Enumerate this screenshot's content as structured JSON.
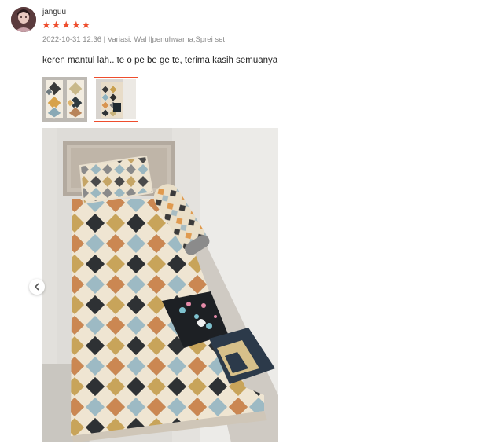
{
  "review": {
    "username": "janguu",
    "rating": 5,
    "meta": "2022-10-31 12:36 | Variasi: Wal l|penuhwarna,Sprei set",
    "comment": "keren mantul lah.. te o pe be ge te, terima kasih semuanya"
  },
  "icons": {
    "star": "star-icon",
    "prev": "chevron-left-icon"
  },
  "colors": {
    "star": "#ee4d2d",
    "selected_thumb_border": "#ee4d2d",
    "meta_text": "#8a8a8a"
  },
  "media": {
    "thumbnails": [
      {
        "name": "bedsheet-flatlay-photo"
      },
      {
        "name": "bed-photo",
        "selected": true
      }
    ]
  }
}
